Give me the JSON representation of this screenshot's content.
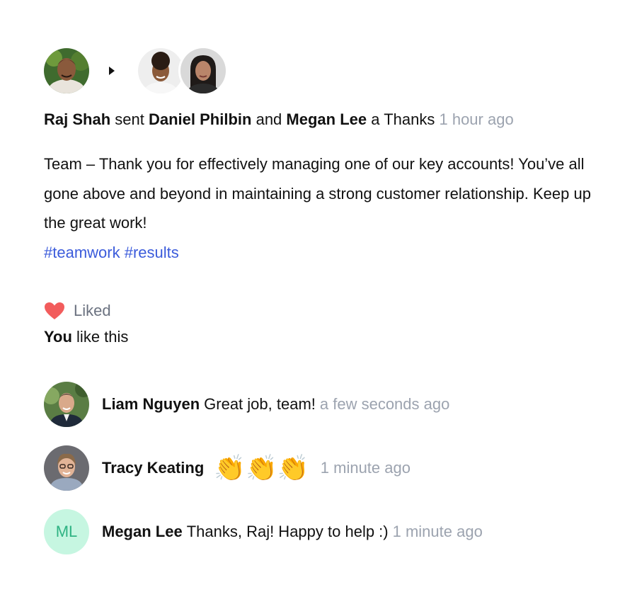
{
  "post": {
    "sender": "Raj Shah",
    "verb_sent": "sent",
    "recipient_1": "Daniel Philbin",
    "conj_and": "and",
    "recipient_2": "Megan Lee",
    "verb_a_thanks": "a Thanks",
    "time": "1 hour ago",
    "message": "Team – Thank you for effectively managing one of our key accounts! You’ve all gone above and beyond in maintaining a strong customer relationship. Keep up the great work!",
    "tags": "#teamwork #results"
  },
  "likes": {
    "label": "Liked",
    "icon": "heart-icon",
    "heart_color": "#f25c5c",
    "you": "You",
    "like_text": "like this"
  },
  "comments": [
    {
      "author": "Liam Nguyen",
      "text": "Great job, team!",
      "time": "a few seconds ago"
    },
    {
      "author": "Tracy Keating",
      "text": "👏👏👏",
      "time": "1 minute ago"
    },
    {
      "author": "Megan Lee",
      "initials": "ML",
      "text": "Thanks, Raj! Happy to help :)",
      "time": "1 minute ago",
      "initials_bg": "#c6f6e1",
      "initials_color": "#2fb383"
    }
  ],
  "colors": {
    "link": "#3b5bdb",
    "muted": "#9ca3af"
  }
}
